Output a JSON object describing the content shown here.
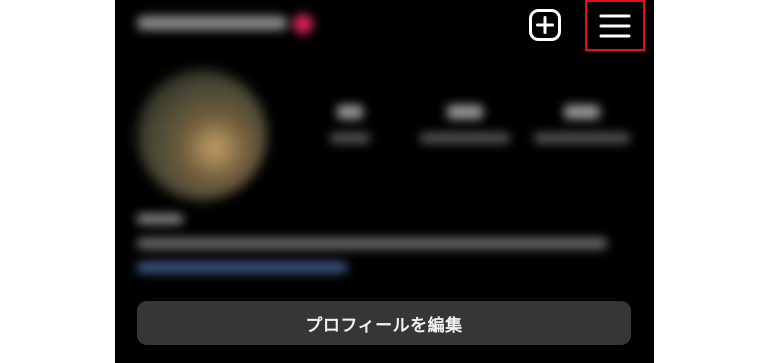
{
  "header": {
    "new_post_icon": "plus-square-icon",
    "menu_icon": "hamburger-menu-icon",
    "menu_highlight_color": "#e3101a"
  },
  "profile": {
    "edit_profile_label": "プロフィールを編集"
  },
  "colors": {
    "background": "#000000",
    "button_bg": "#363636",
    "text": "#f2f2f2"
  }
}
